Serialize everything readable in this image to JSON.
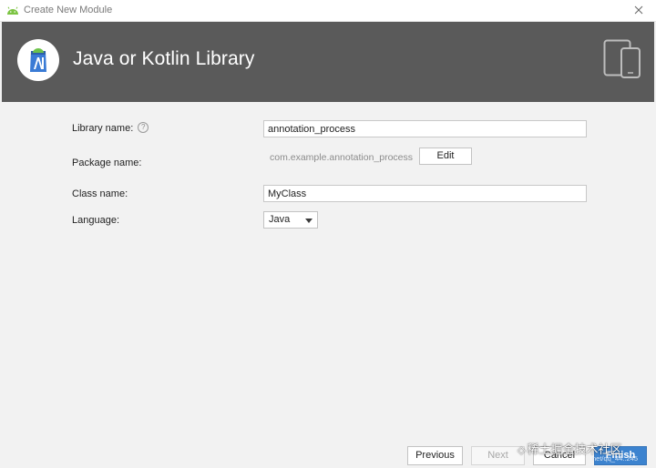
{
  "window": {
    "title": "Create New Module",
    "close_icon": "close-icon"
  },
  "banner": {
    "heading": "Java or Kotlin Library",
    "logo_icon": "android-studio-logo-icon",
    "devices_icon": "tablet-phone-icon",
    "background": "#5a5a5a"
  },
  "form": {
    "library_name": {
      "label": "Library name:",
      "help_icon": "?",
      "value": "annotation_process"
    },
    "package_name": {
      "label": "Package name:",
      "value": "com.example.annotation_process",
      "edit_label": "Edit"
    },
    "class_name": {
      "label": "Class name:",
      "value": "MyClass"
    },
    "language": {
      "label": "Language:",
      "selected": "Java"
    }
  },
  "footer": {
    "previous_label": "Previous",
    "next_label": "Next",
    "cancel_label": "Cancel",
    "finish_label": "Finish",
    "accent": "#3c83cf"
  },
  "watermark": {
    "text": "稀土掘金技术社区",
    "small_text": "net/qq_44..245"
  }
}
